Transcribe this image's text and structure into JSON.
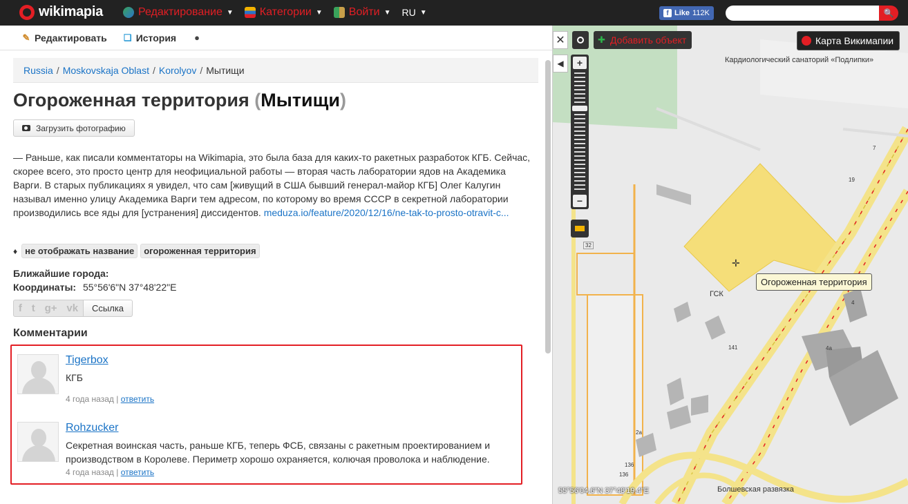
{
  "topbar": {
    "logo": "wikimapia",
    "menu": [
      {
        "label": "Редактирование"
      },
      {
        "label": "Категории"
      },
      {
        "label": "Войти"
      }
    ],
    "lang": "RU",
    "fb_like": "Like",
    "fb_count": "112K",
    "search_placeholder": ""
  },
  "tabs": {
    "edit": "Редактировать",
    "history": "История"
  },
  "breadcrumb": {
    "items": [
      "Russia",
      "Moskovskaja Oblast",
      "Korolyov"
    ],
    "current": "Мытищи"
  },
  "title": {
    "main": "Огороженная территория",
    "open": "(",
    "city": "Мытищи",
    "close": ")"
  },
  "upload_label": "Загрузить фотографию",
  "description": {
    "text": "— Раньше, как писали комментаторы на Wikimapia, это была база для каких-то ракетных разработок КГБ. Сейчас, скорее всего, это просто центр для неофициальной работы — вторая часть лаборатории ядов на Академика Варги. В старых публикациях я увидел, что сам [живущий в США бывший генерал-майор КГБ] Олег Калугин называл именно улицу Академика Варги тем адресом, по которому во время СССР в секретной лаборатории производились все яды для [устранения] диссидентов. ",
    "link": "meduza.io/feature/2020/12/16/ne-tak-to-prosto-otravit-c..."
  },
  "tags": [
    "не отображать название",
    "огороженная территория"
  ],
  "nearest_label": "Ближайшие города:",
  "coords_label": "Координаты:",
  "coords_value": "55°56'6\"N 37°48'22\"E",
  "share_link_label": "Ссылка",
  "comments_heading": "Комментарии",
  "comments": [
    {
      "author": "Tigerbox",
      "text": "КГБ",
      "time": "4 года назад",
      "sep": "|",
      "reply": "ответить"
    },
    {
      "author": "Rohzucker",
      "text": "Секретная воинская часть, раньше КГБ, теперь ФСБ, связаны с ракетным проектированием и производством в Королеве. Периметр хорошо охраняется, колючая проволока и наблюдение.",
      "time": "4 года назад",
      "sep": "|",
      "reply": "ответить"
    }
  ],
  "map": {
    "add_object": "Добавить объект",
    "wikimapia_map": "Карта Викимапии",
    "label_sanatorium": "Кардиологический санаторий «Подлипки»",
    "label_gsk": "ГСК",
    "label_interchange": "Болшевская развязка",
    "tooltip": "Огороженная территория",
    "coord_readout": "55°56'04.6\"N 37°48'19.4\"E",
    "house_numbers": [
      "7",
      "19",
      "4",
      "4а",
      "141",
      "32",
      "2а",
      "136",
      "136"
    ]
  },
  "colors": {
    "accent": "#e31e24",
    "link": "#1a73c6",
    "highlight_border": "#e31e24",
    "polygon_fill": "#f5de79"
  }
}
